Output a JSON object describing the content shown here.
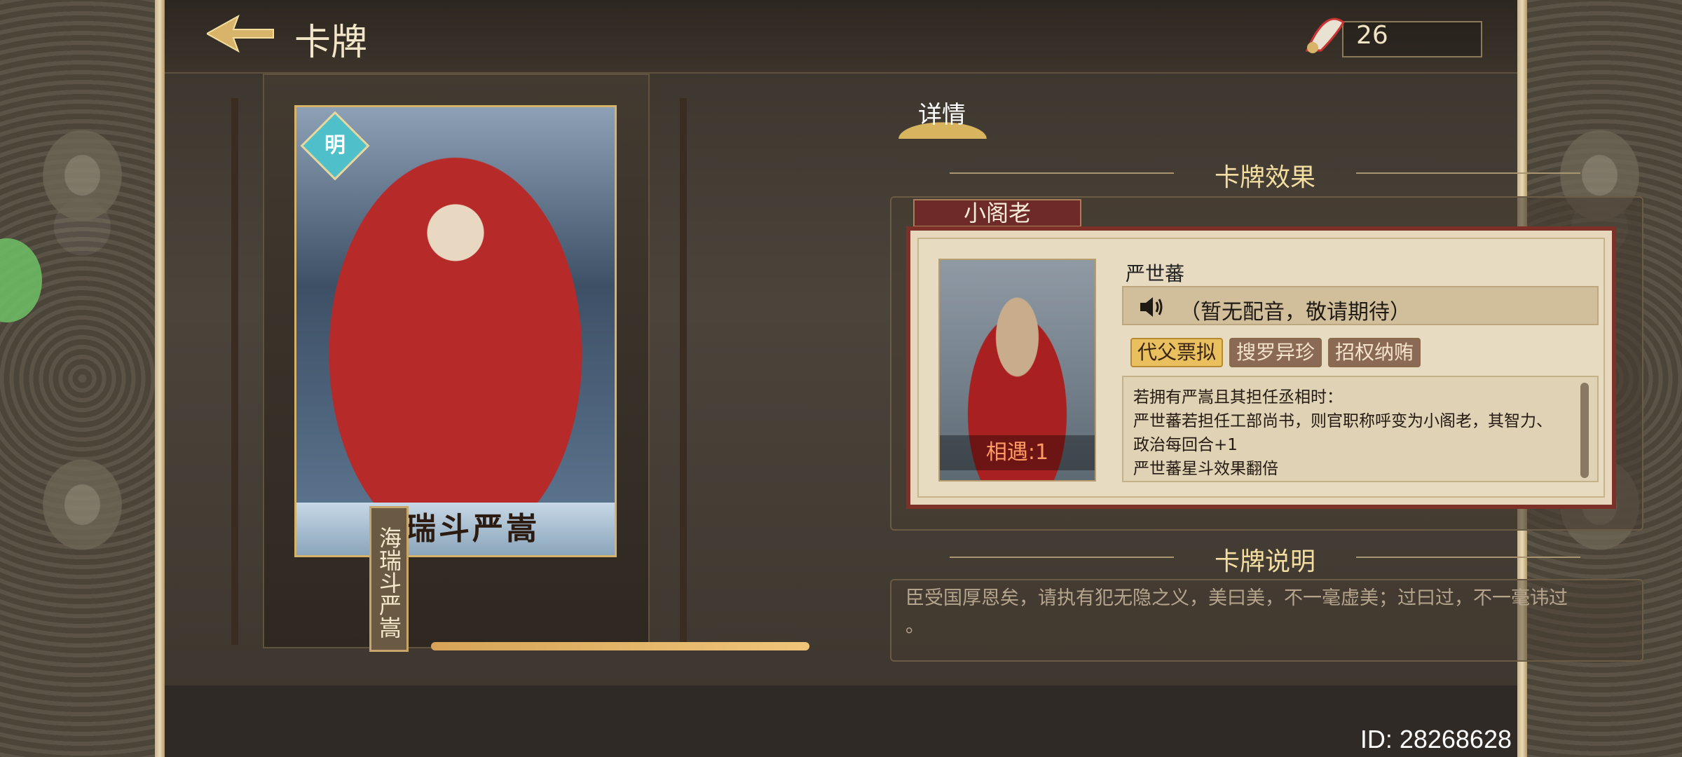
{
  "header": {
    "title": "卡牌",
    "currency_value": "26"
  },
  "card": {
    "faction_badge": "明",
    "name_banner": "海瑞斗严嵩",
    "vertical_label": "海瑞斗严嵩",
    "progress_ratio": 1.0
  },
  "detail": {
    "tab_label": "详情",
    "effect_section_title": "卡牌效果",
    "effect_tab_label": "小阁老",
    "hero_name": "严世蕃",
    "voice_text": "（暂无配音，敬请期待）",
    "meet_label": "相遇:1",
    "tags": [
      {
        "label": "代父票拟",
        "active": true
      },
      {
        "label": "搜罗异珍",
        "active": false
      },
      {
        "label": "招权纳贿",
        "active": false
      }
    ],
    "description_lines": [
      "若拥有严嵩且其担任丞相时：",
      "严世蕃若担任工部尚书，则官职称呼变为小阁老，其智力、",
      "政治每回合+1",
      "严世蕃星斗效果翻倍"
    ],
    "explain_section_title": "卡牌说明",
    "explain_text": "臣受国厚恩矣，请执有犯无隐之义，美曰美，不一毫虚美；过曰过，不一毫讳过",
    "explain_text_tail": "。"
  },
  "footer": {
    "user_id": "ID: 28268628"
  },
  "icons": {
    "back": "back-arrow-icon",
    "currency": "feather-fan-icon",
    "speaker": "speaker-icon"
  },
  "colors": {
    "accent_gold": "#f3dda0",
    "frame_red": "#7c3027",
    "active_tag": "#e9c05d",
    "meet_orange": "#ff9b63"
  }
}
